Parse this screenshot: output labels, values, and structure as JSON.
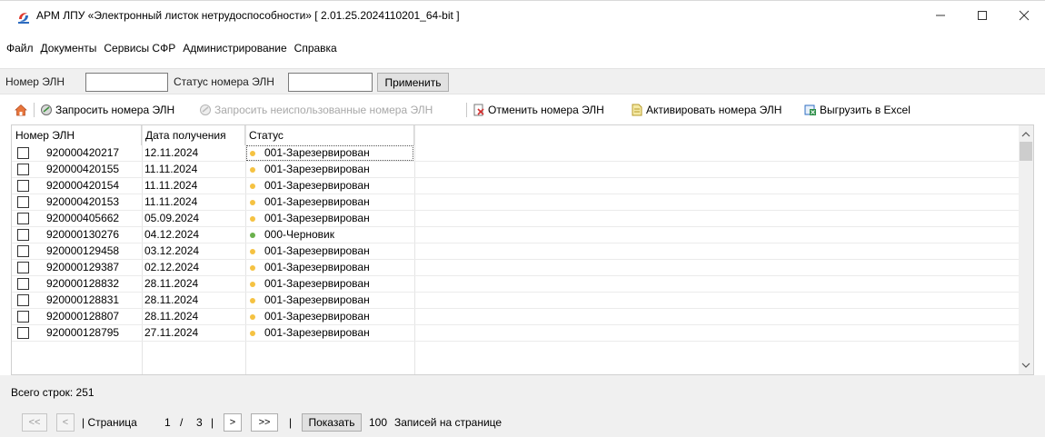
{
  "window": {
    "title": "АРМ ЛПУ «Электронный листок нетрудоспособности» [ 2.01.25.2024110201_64-bit ]",
    "minimize": "—",
    "maximize": "☐",
    "close": "✕"
  },
  "menu": [
    "Файл",
    "Документы",
    "Сервисы СФР",
    "Администрирование",
    "Справка"
  ],
  "filter": {
    "eln_label": "Номер ЭЛН",
    "eln_value": "",
    "status_label": "Статус номера ЭЛН",
    "status_value": "",
    "apply_label": "Применить"
  },
  "toolbar": {
    "home_icon": "home-icon",
    "request": "Запросить номера ЭЛН",
    "request_unused": "Запросить неиспользованные номера ЭЛН",
    "cancel": "Отменить номера ЭЛН",
    "activate": "Активировать номера ЭЛН",
    "export": "Выгрузить в Excel"
  },
  "table": {
    "columns": [
      "Номер ЭЛН",
      "Дата получения",
      "Статус"
    ],
    "rows": [
      {
        "num": "920000420217",
        "date": "12.11.2024",
        "status": "001-Зарезервирован",
        "color": "#f5c242"
      },
      {
        "num": "920000420155",
        "date": "11.11.2024",
        "status": "001-Зарезервирован",
        "color": "#f5c242"
      },
      {
        "num": "920000420154",
        "date": "11.11.2024",
        "status": "001-Зарезервирован",
        "color": "#f5c242"
      },
      {
        "num": "920000420153",
        "date": "11.11.2024",
        "status": "001-Зарезервирован",
        "color": "#f5c242"
      },
      {
        "num": "920000405662",
        "date": "05.09.2024",
        "status": "001-Зарезервирован",
        "color": "#f5c242"
      },
      {
        "num": "920000130276",
        "date": "04.12.2024",
        "status": "000-Черновик",
        "color": "#6ab04c"
      },
      {
        "num": "920000129458",
        "date": "03.12.2024",
        "status": "001-Зарезервирован",
        "color": "#f5c242"
      },
      {
        "num": "920000129387",
        "date": "02.12.2024",
        "status": "001-Зарезервирован",
        "color": "#f5c242"
      },
      {
        "num": "920000128832",
        "date": "28.11.2024",
        "status": "001-Зарезервирован",
        "color": "#f5c242"
      },
      {
        "num": "920000128831",
        "date": "28.11.2024",
        "status": "001-Зарезервирован",
        "color": "#f5c242"
      },
      {
        "num": "920000128807",
        "date": "28.11.2024",
        "status": "001-Зарезервирован",
        "color": "#f5c242"
      },
      {
        "num": "920000128795",
        "date": "27.11.2024",
        "status": "001-Зарезервирован",
        "color": "#f5c242"
      }
    ]
  },
  "footer": {
    "total": "Всего строк: 251",
    "first": "<<",
    "prev": "<",
    "page_prefix": "| Страница",
    "page": "1",
    "page_sep": "/",
    "page_total": "3",
    "page_suffix": "|",
    "next": ">",
    "last": ">>",
    "pipe2": "|",
    "show": "Показать",
    "per_page": "100",
    "per_page_label": "Записей на странице"
  }
}
